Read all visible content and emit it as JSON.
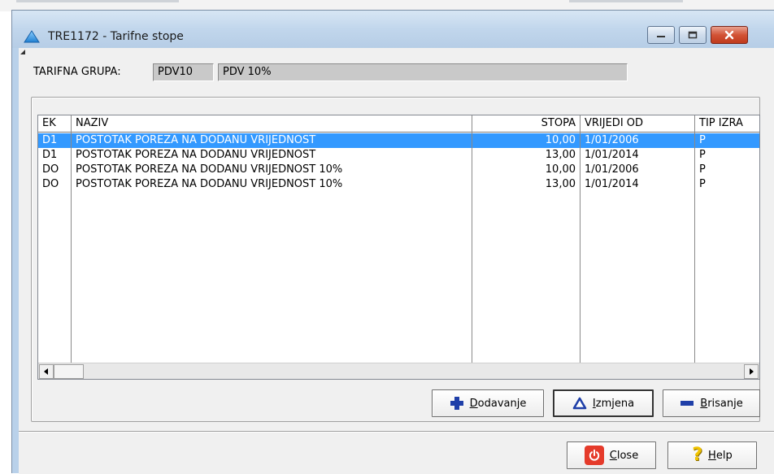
{
  "window": {
    "title": "TRE1172 - Tarifne stope"
  },
  "tarifna_grupa": {
    "label": "TARIFNA GRUPA:",
    "code": "PDV10",
    "description": "PDV 10%"
  },
  "grid": {
    "columns": [
      "EK",
      "NAZIV",
      "STOPA",
      "VRIJEDI OD",
      "TIP IZRA"
    ],
    "rows": [
      {
        "ek": "D1",
        "naziv": "POSTOTAK POREZA NA DODANU VRIJEDNOST",
        "stopa": "10,00",
        "vrijedi_od": "1/01/2006",
        "tip": "P"
      },
      {
        "ek": "D1",
        "naziv": "POSTOTAK POREZA NA DODANU VRIJEDNOST",
        "stopa": "13,00",
        "vrijedi_od": "1/01/2014",
        "tip": "P"
      },
      {
        "ek": "DO",
        "naziv": "POSTOTAK POREZA NA DODANU VRIJEDNOST 10%",
        "stopa": "10,00",
        "vrijedi_od": "1/01/2006",
        "tip": "P"
      },
      {
        "ek": "DO",
        "naziv": "POSTOTAK POREZA NA DODANU VRIJEDNOST 10%",
        "stopa": "13,00",
        "vrijedi_od": "1/01/2014",
        "tip": "P"
      }
    ],
    "selected_row": 0
  },
  "buttons": {
    "add": {
      "mnemonic": "D",
      "rest": "odavanje"
    },
    "edit": {
      "mnemonic": "I",
      "rest": "zmjena"
    },
    "delete": {
      "mnemonic": "B",
      "rest": "risanje"
    },
    "close": {
      "mnemonic": "C",
      "rest": "lose"
    },
    "help": {
      "mnemonic": "H",
      "rest": "elp"
    }
  },
  "colors": {
    "selection": "#3399ff",
    "frame": "#b9d1ea",
    "close_red": "#e53b2b",
    "add_blue": "#1f3fa8"
  },
  "icons": {
    "app": "triangle-app-icon",
    "add": "plus-icon",
    "edit": "triangle-icon",
    "delete": "minus-icon",
    "close": "power-icon",
    "help": "question-mark-icon"
  }
}
